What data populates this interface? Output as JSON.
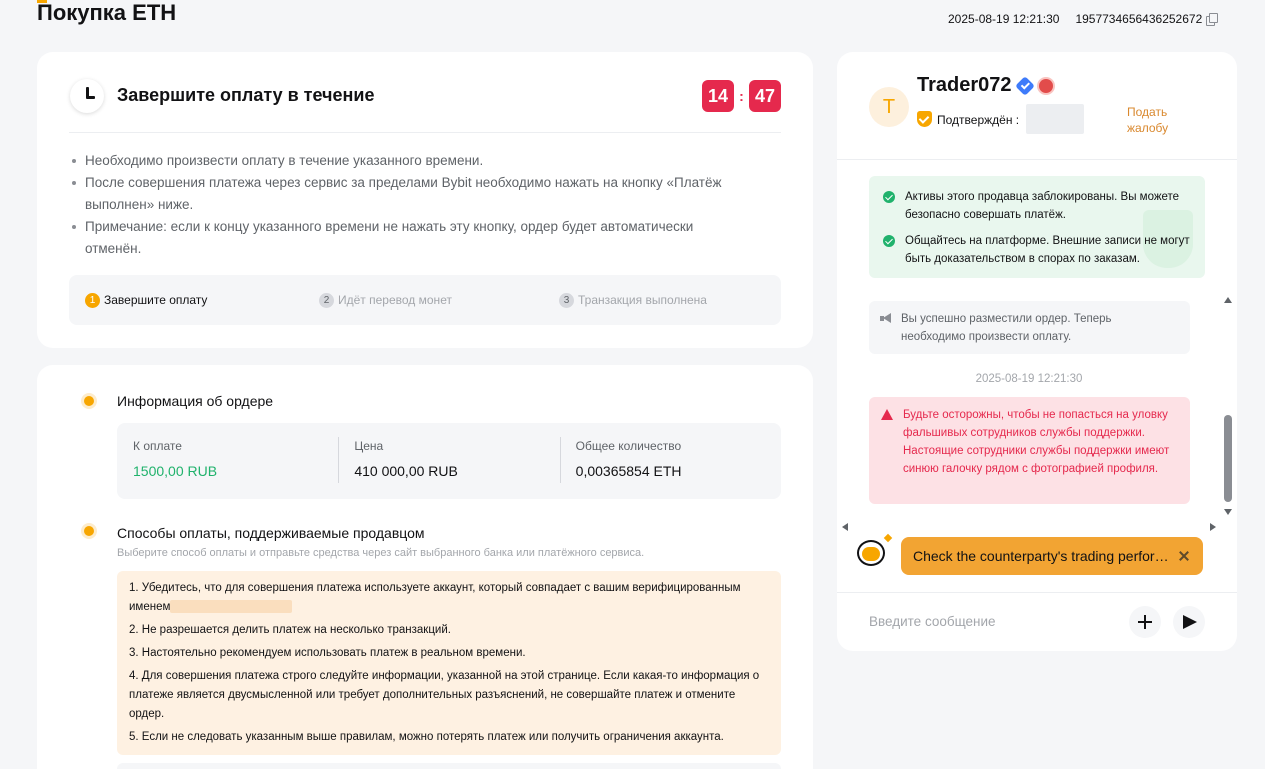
{
  "header": {
    "title": "Покупка ETH",
    "datetime": "2025-08-19 12:21:30",
    "order_id": "1957734656436252672"
  },
  "timer": {
    "title": "Завершите оплату в течение",
    "minutes": "14",
    "separator": ":",
    "seconds": "47",
    "notes": [
      "Необходимо произвести оплату в течение указанного времени.",
      "После совершения платежа через сервис за пределами Bybit необходимо нажать на кнопку «Платёж выполнен» ниже.",
      "Примечание: если к концу указанного времени не нажать эту кнопку, ордер будет автоматически отменён."
    ],
    "steps": [
      {
        "num": "1",
        "label": "Завершите оплату"
      },
      {
        "num": "2",
        "label": "Идёт перевод монет"
      },
      {
        "num": "3",
        "label": "Транзакция выполнена"
      }
    ]
  },
  "order": {
    "info_title": "Информация об ордере",
    "to_pay_label": "К оплате",
    "to_pay_value": "1500,00 RUB",
    "price_label": "Цена",
    "price_value": "410 000,00 RUB",
    "quantity_label": "Общее количество",
    "quantity_value": "0,00365854 ETH",
    "methods_title": "Способы оплаты, поддерживаемые продавцом",
    "methods_subtitle": "Выберите способ оплаты и отправьте средства через сайт выбранного банка или платёжного сервиса.",
    "rules": [
      "1. Убедитесь, что для совершения платежа используете аккаунт, который совпадает с вашим верифицированным именем",
      "2. Не разрешается делить платеж на несколько транзакций.",
      "3. Настоятельно рекомендуем использовать платеж в реальном времени.",
      "4. Для совершения платежа строго следуйте информации, указанной на этой странице. Если какая-то информация о платеже является двусмысленной или требует дополнительных разъяснений, не совершайте платеж и отмените ордер.",
      "5. Если не следовать указанным выше правилам, можно потерять платеж или получить ограничения аккаунта."
    ]
  },
  "chat": {
    "avatar_letter": "T",
    "trader_name": "Trader072",
    "verified_label": "Подтверждён :",
    "complain_link": "Подать жалобу",
    "safety_notes": [
      "Активы этого продавца заблокированы. Вы можете безопасно совершать платёж.",
      "Общайтесь на платформе. Внешние записи не могут быть доказательством в спорах по заказам."
    ],
    "system_message": "Вы успешно разместили ордер. Теперь необходимо произвести оплату.",
    "timestamp": "2025-08-19 12:21:30",
    "warning_message": "Будьте осторожны, чтобы не попасться на уловку фальшивых сотрудников службы поддержки. Настоящие сотрудники службы поддержки имеют синюю галочку рядом с фотографией профиля.",
    "assistant_text": "Check the counterparty's trading performance",
    "input_placeholder": "Введите сообщение"
  },
  "colors": {
    "accent": "#f7a600",
    "timer_red": "#e5294d",
    "success_green": "#20b26c",
    "verified_blue": "#3e7bfa"
  },
  "icons": [
    "clock-icon",
    "copy-icon",
    "verified-icon",
    "merchant-badge-icon",
    "shield-icon",
    "check-icon",
    "megaphone-icon",
    "warning-icon",
    "assistant-icon",
    "close-icon",
    "plus-icon",
    "send-icon"
  ]
}
